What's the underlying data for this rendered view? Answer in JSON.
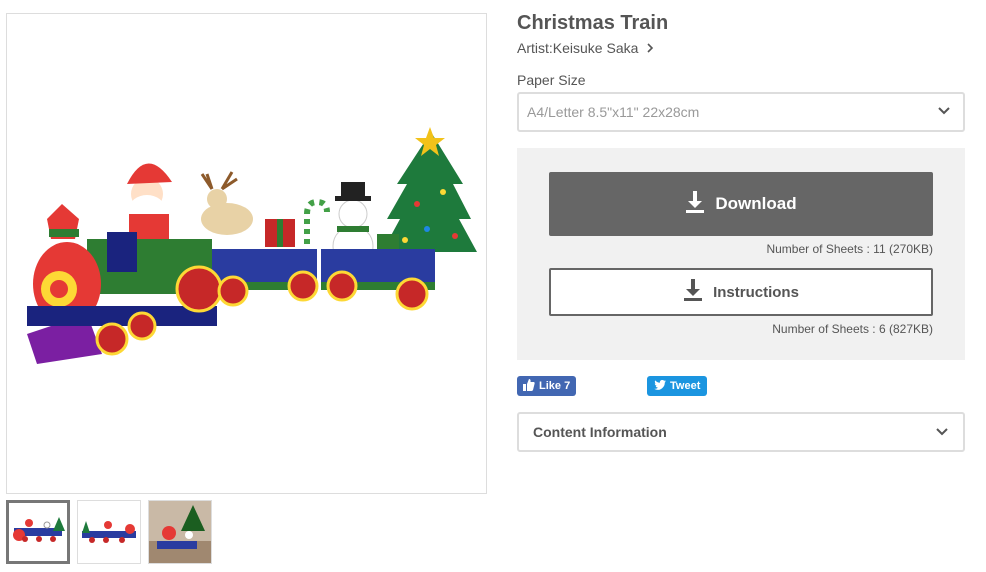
{
  "product": {
    "title": "Christmas Train",
    "artist_label": "Artist:Keisuke Saka"
  },
  "paper_size": {
    "label": "Paper Size",
    "selected": "A4/Letter 8.5\"x11\" 22x28cm"
  },
  "download": {
    "download_label": "Download",
    "download_sheets": "Number of Sheets : 11 (270KB)",
    "instructions_label": "Instructions",
    "instructions_sheets": "Number of Sheets : 6 (827KB)"
  },
  "social": {
    "like_label": "Like 7",
    "tweet_label": "Tweet"
  },
  "content_info": {
    "label": "Content Information"
  },
  "icons": {
    "artist_chevron": "chevron-right-icon",
    "select_chevron": "chevron-down-icon",
    "download": "download-icon",
    "like": "thumbs-up-icon",
    "tweet": "twitter-bird-icon"
  },
  "colors": {
    "download_button": "#666666",
    "panel_background": "#f1f1f1",
    "facebook": "#4267b2",
    "twitter": "#1b95e0"
  }
}
